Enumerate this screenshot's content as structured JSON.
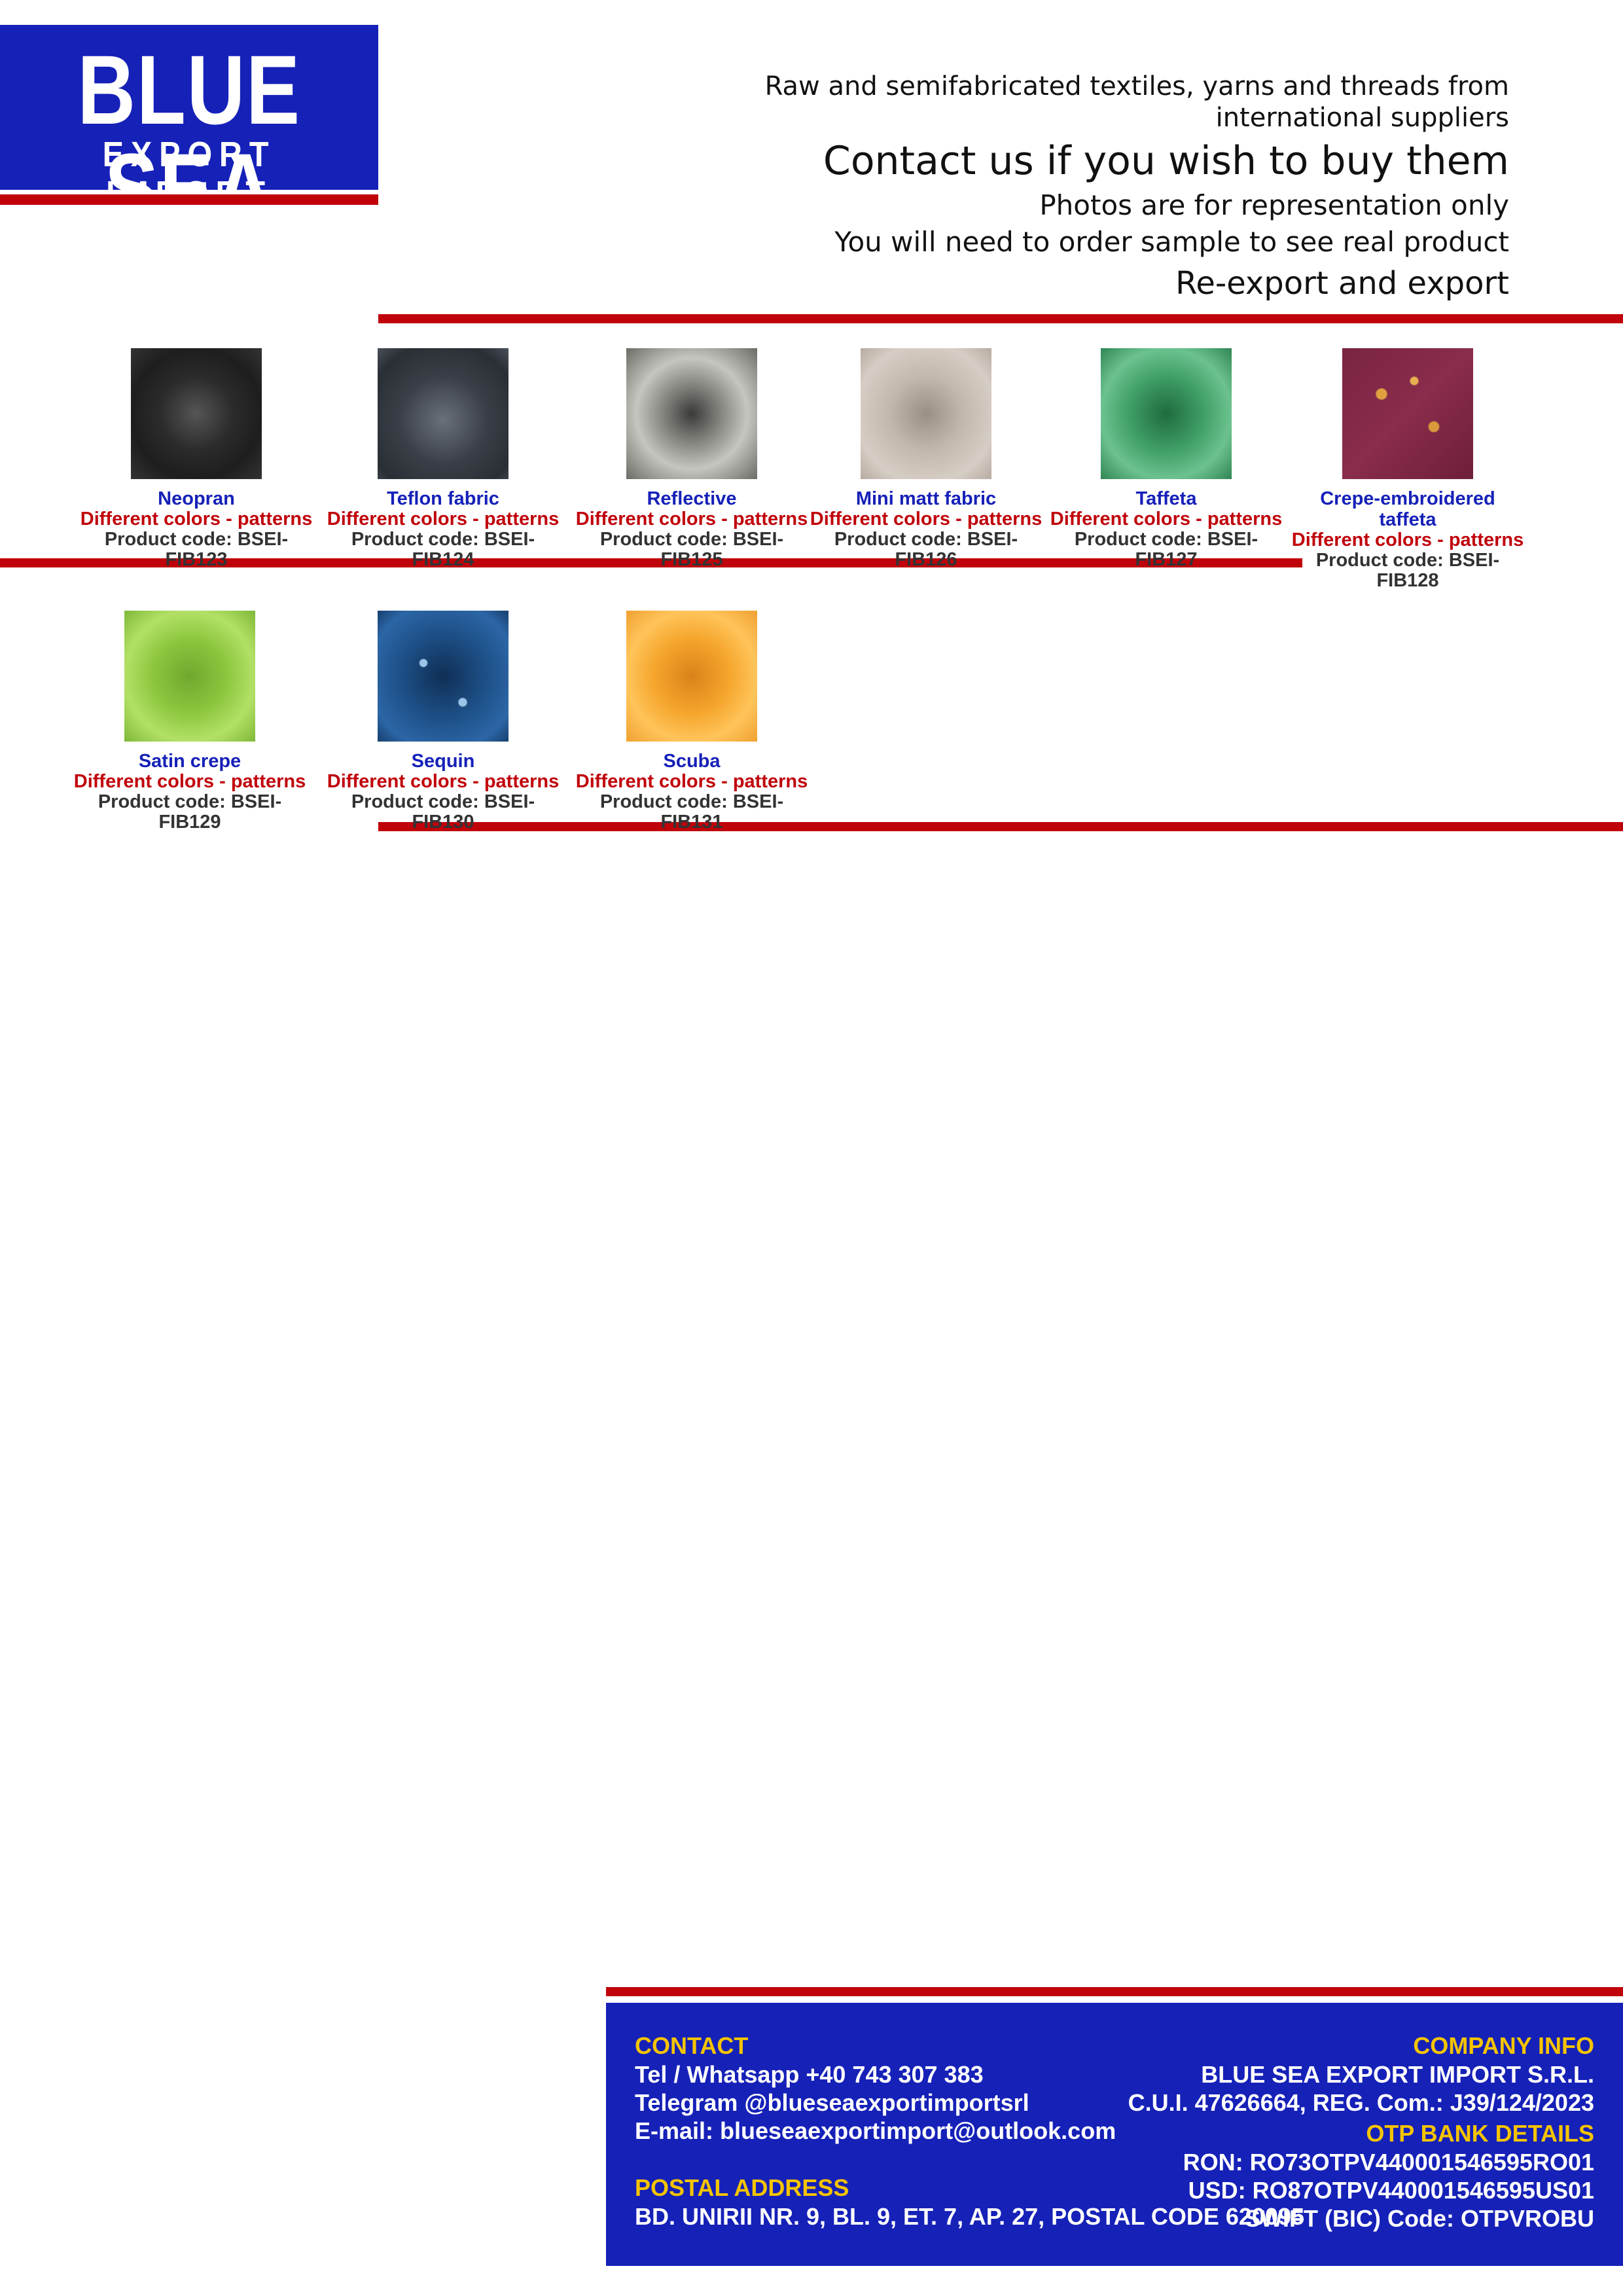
{
  "logo": {
    "line1": "BLUE SEA",
    "line2": "EXPORT IMPORT"
  },
  "header": {
    "line1a": "Raw and semifabricated textiles, yarns and threads from",
    "line1b": "international suppliers",
    "contact": "Contact us if you wish to buy them",
    "photos": "Photos are for representation only",
    "sample": "You will need to order sample to see real product",
    "reexport": "Re-export and export"
  },
  "colors": {
    "brand_blue": "#1621b8",
    "accent_red": "#c0020b",
    "footer_heading": "#f5c400"
  },
  "products": [
    {
      "name": "Neopran",
      "variants": "Different colors - patterns",
      "code": "Product code: BSEI-FIB123",
      "swatch_color": "#2b2b2b"
    },
    {
      "name": "Teflon fabric",
      "variants": "Different colors - patterns",
      "code": "Product code: BSEI-FIB124",
      "swatch_color": "#3a3f47"
    },
    {
      "name": "Reflective",
      "variants": "Different colors - patterns",
      "code": "Product code: BSEI-FIB125",
      "swatch_color": "#8d8d88"
    },
    {
      "name": "Mini matt fabric",
      "variants": "Different colors - patterns",
      "code": "Product code: BSEI-FIB126",
      "swatch_color": "#c2b8ae"
    },
    {
      "name": "Taffeta",
      "variants": "Different colors - patterns",
      "code": "Product code: BSEI-FIB127",
      "swatch_color": "#3f9e66"
    },
    {
      "name": "Crepe-embroidered taffeta",
      "variants": "Different colors - patterns",
      "code": "Product code: BSEI-FIB128",
      "swatch_color": "#8a2c4c"
    },
    {
      "name": "Satin crepe",
      "variants": "Different colors - patterns",
      "code": "Product code: BSEI-FIB129",
      "swatch_color": "#8cc63e"
    },
    {
      "name": "Sequin",
      "variants": "Different colors - patterns",
      "code": "Product code: BSEI-FIB130",
      "swatch_color": "#1d4f86"
    },
    {
      "name": "Scuba",
      "variants": "Different colors - patterns",
      "code": "Product code: BSEI-FIB131",
      "swatch_color": "#f5a52c"
    }
  ],
  "footer": {
    "contact_heading": "CONTACT",
    "phone": "Tel / Whatsapp +40 743 307 383",
    "telegram": "Telegram @blueseaexportimportsrl",
    "email": "E-mail: blueseaexportimport@outlook.com",
    "address_heading": "POSTAL ADDRESS",
    "address": "BD. UNIRII NR. 9, BL. 9, ET. 7, AP. 27, POSTAL CODE 620095",
    "company_heading": "COMPANY INFO",
    "company_name": "BLUE SEA EXPORT IMPORT S.R.L.",
    "company_ids": "C.U.I. 47626664, REG. Com.: J39/124/2023",
    "bank_heading": "OTP BANK DETAILS",
    "ron": "RON: RO73OTPV440001546595RO01",
    "usd": "USD: RO87OTPV440001546595US01",
    "swift": "SWIFT (BIC) Code: OTPVROBU"
  }
}
